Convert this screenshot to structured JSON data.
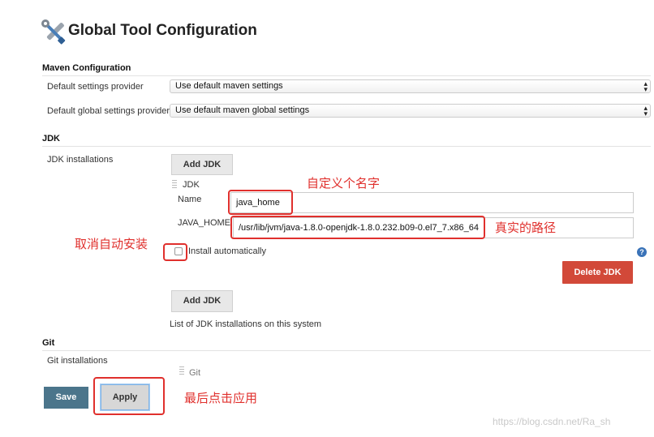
{
  "page": {
    "title": "Global Tool Configuration"
  },
  "maven": {
    "section_title": "Maven Configuration",
    "default_settings_label": "Default settings provider",
    "default_settings_value": "Use default maven settings",
    "global_settings_label": "Default global settings provider",
    "global_settings_value": "Use default maven global settings"
  },
  "jdk": {
    "section_title": "JDK",
    "installations_label": "JDK installations",
    "add_jdk_label": "Add JDK",
    "item_header": "JDK",
    "name_label": "Name",
    "name_value": "java_home",
    "java_home_label": "JAVA_HOME",
    "java_home_value": "/usr/lib/jvm/java-1.8.0-openjdk-1.8.0.232.b09-0.el7_7.x86_64",
    "install_auto_label": "Install automatically",
    "install_auto_checked": false,
    "delete_jdk_label": "Delete JDK",
    "help_glyph": "?",
    "list_desc": "List of JDK installations on this system"
  },
  "git": {
    "section_title": "Git",
    "installations_label": "Git installations",
    "item_header": "Git"
  },
  "footer": {
    "save_label": "Save",
    "apply_label": "Apply"
  },
  "annotations": {
    "custom_name": "自定义个名字",
    "real_path": "真实的路径",
    "cancel_auto_install": "取消自动安装",
    "finally_apply": "最后点击应用"
  },
  "watermark": "https://blog.csdn.net/Ra_sh",
  "colors": {
    "annotation_red": "#e0302d",
    "delete_red": "#d24939",
    "save_blue": "#4b758b"
  }
}
